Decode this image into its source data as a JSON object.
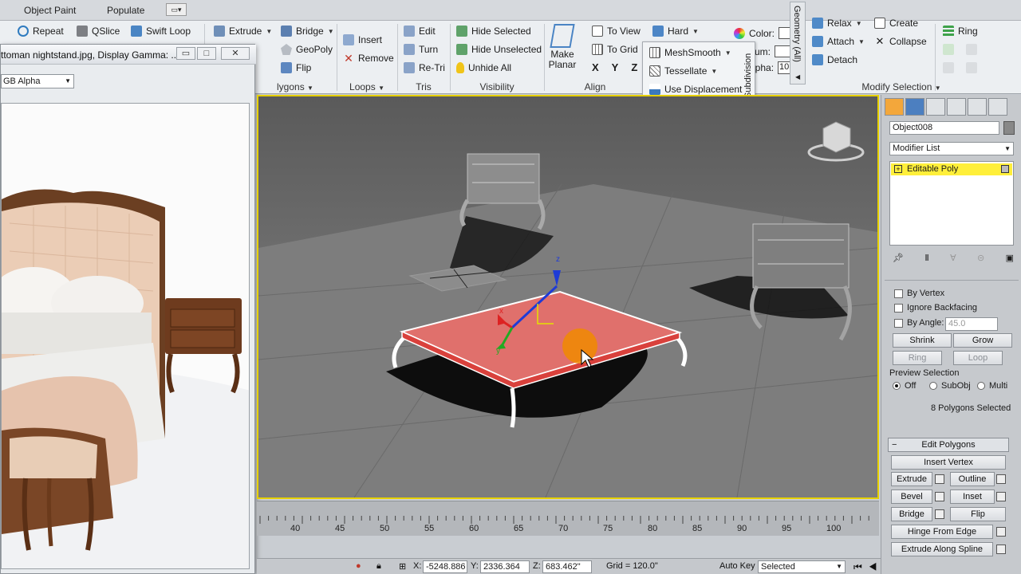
{
  "tabs": {
    "object_paint": "Object Paint",
    "populate": "Populate"
  },
  "ribbon": {
    "repeat": "Repeat",
    "qslice": "QSlice",
    "swift_loop": "Swift Loop",
    "extrude": "Extrude",
    "bridge": "Bridge",
    "geopoly": "GeoPoly",
    "flip": "Flip",
    "insert": "Insert",
    "remove": "Remove",
    "edit": "Edit",
    "turn": "Turn",
    "retri": "Re-Tri",
    "hide_selected": "Hide Selected",
    "hide_unselected": "Hide Unselected",
    "unhide_all": "Unhide All",
    "make_planar": "Make Planar",
    "to_view": "To View",
    "to_grid": "To Grid",
    "x": "X",
    "y": "Y",
    "z": "Z",
    "hard": "Hard",
    "meshsmooth": "MeshSmooth",
    "tessellate": "Tessellate",
    "use_displacement": "Use Displacement",
    "subdivision": "Subdivision",
    "color": "Color:",
    "um": "um:",
    "alpha": "lpha:",
    "alpha_value": "10",
    "geometry_all": "Geometry (All)",
    "relax": "Relax",
    "create": "Create",
    "attach": "Attach",
    "collapse": "Collapse",
    "detach": "Detach",
    "ring": "Ring",
    "groups": {
      "polygons": "lygons",
      "loops": "Loops",
      "tris": "Tris",
      "visibility": "Visibility",
      "align": "Align",
      "modify_selection": "Modify Selection"
    }
  },
  "image_window": {
    "title": "ttoman nightstand.jpg, Display Gamma: ...",
    "channel": "GB Alpha",
    "btn_min": "▭",
    "btn_max": "□",
    "btn_close": "✕"
  },
  "viewport": {
    "gizmo_z": "z",
    "gizmo_x": "x",
    "gizmo_y": "y"
  },
  "timeline": {
    "ticks": [
      "40",
      "45",
      "50",
      "55",
      "60",
      "65",
      "70",
      "75",
      "80",
      "85",
      "90",
      "95",
      "100"
    ]
  },
  "statusbar": {
    "x_label": "X:",
    "x_value": "-5248.886",
    "y_label": "Y:",
    "y_value": "2336.364",
    "z_label": "Z:",
    "z_value": "683.462\"",
    "grid": "Grid = 120.0\"",
    "auto_key": "Auto Key",
    "selected": "Selected"
  },
  "command_panel": {
    "object_name": "Object008",
    "modifier_list": "Modifier List",
    "stack_item": "Editable Poly",
    "by_vertex": "By Vertex",
    "ignore_backfacing": "Ignore Backfacing",
    "by_angle": "By Angle:",
    "angle_value": "45.0",
    "shrink": "Shrink",
    "grow": "Grow",
    "ring": "Ring",
    "loop": "Loop",
    "preview_selection": "Preview Selection",
    "off": "Off",
    "subobj": "SubObj",
    "multi": "Multi",
    "selection_status": "8 Polygons Selected",
    "rollout_toggle": "−",
    "edit_polygons": "Edit Polygons",
    "insert_vertex": "Insert Vertex",
    "extrude": "Extrude",
    "outline": "Outline",
    "bevel": "Bevel",
    "inset": "Inset",
    "bridge": "Bridge",
    "flip": "Flip",
    "hinge_from_edge": "Hinge From Edge",
    "extrude_along_spline": "Extrude Along Spline"
  },
  "colors": {
    "selection_red": "#e0706c",
    "viewport_frame": "#e6d000",
    "stack_highlight": "#ffef3a"
  }
}
